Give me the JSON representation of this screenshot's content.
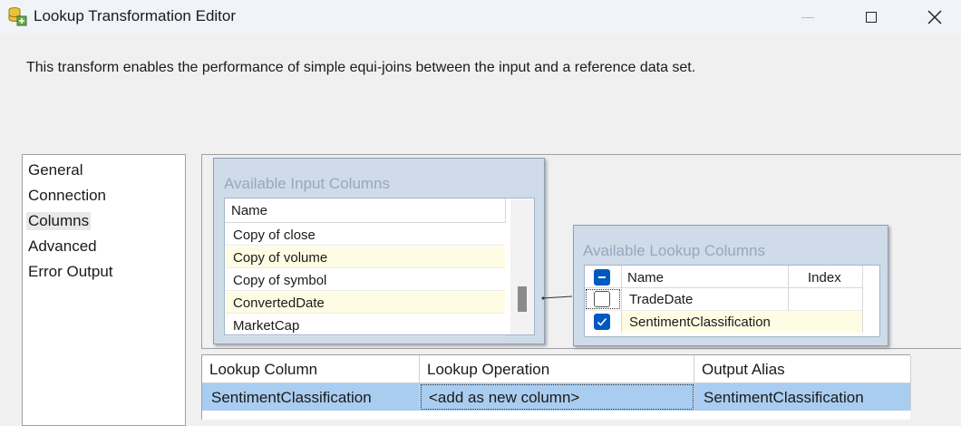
{
  "window": {
    "title": "Lookup Transformation Editor",
    "icon": "lookup-transform-icon"
  },
  "description": "This transform enables the performance of simple equi-joins between the input and a reference data set.",
  "nav": {
    "items": [
      {
        "label": "General",
        "selected": false
      },
      {
        "label": "Connection",
        "selected": false
      },
      {
        "label": "Columns",
        "selected": true
      },
      {
        "label": "Advanced",
        "selected": false
      },
      {
        "label": "Error Output",
        "selected": false
      }
    ]
  },
  "input_columns": {
    "title": "Available Input Columns",
    "header": "Name",
    "rows": [
      "Copy of close",
      "Copy of volume",
      "Copy of symbol",
      "ConvertedDate",
      "MarketCap"
    ]
  },
  "lookup_columns": {
    "title": "Available Lookup Columns",
    "header_name": "Name",
    "header_index": "Index",
    "rows": [
      {
        "name": "TradeDate",
        "checked": false
      },
      {
        "name": "SentimentClassification",
        "checked": true
      }
    ]
  },
  "mapping": {
    "headers": [
      "Lookup Column",
      "Lookup Operation",
      "Output Alias"
    ],
    "row": {
      "lookup_column": "SentimentClassification",
      "lookup_operation": "<add as new column>",
      "output_alias": "SentimentClassification"
    }
  },
  "colors": {
    "box_fill": "#cfdbe9",
    "row_alt": "#fefde4",
    "selection": "#a9cdf0",
    "checkbox_accent": "#0059c1"
  }
}
